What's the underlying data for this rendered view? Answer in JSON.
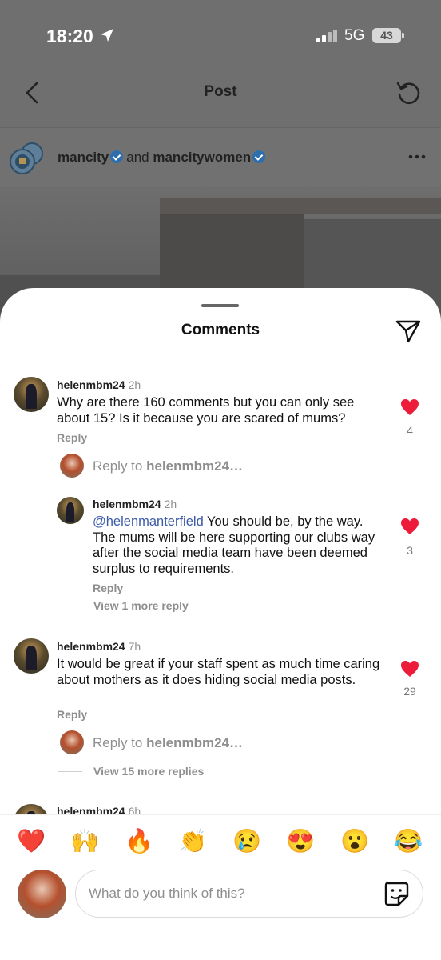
{
  "status_bar": {
    "time": "18:20",
    "network": "5G",
    "battery": "43"
  },
  "header": {
    "title": "Post"
  },
  "post": {
    "author_primary": "mancity",
    "author_joiner": "and",
    "author_secondary": "mancitywomen"
  },
  "sheet": {
    "title": "Comments"
  },
  "comments": [
    {
      "username": "helenmbm24",
      "time": "2h",
      "text": "Why are there 160 comments but you can only see about 15? Is it because you are scared of mums?",
      "likes": "4",
      "reply_label": "Reply",
      "reply_prompt_prefix": "Reply to",
      "reply_prompt_user": "helenmbm24…",
      "reply": {
        "username": "helenmbm24",
        "time": "2h",
        "mention": "@helenmanterfield",
        "text": " You should be, by the way. The mums will be here supporting our clubs way after the social media team have been deemed surplus to requirements.",
        "likes": "3",
        "reply_label": "Reply"
      },
      "more_replies": "View 1 more reply"
    },
    {
      "username": "helenmbm24",
      "time": "7h",
      "text": "It would be great if your staff spent as much time caring about mothers as it does hiding social media posts.",
      "likes": "29",
      "reply_label": "Reply",
      "reply_prompt_prefix": "Reply to",
      "reply_prompt_user": "helenmbm24…",
      "more_replies": "View 15 more replies"
    },
    {
      "username": "helenmbm24",
      "time": "6h"
    }
  ],
  "emoji_bar": [
    "❤️",
    "🙌",
    "🔥",
    "👏",
    "😢",
    "😍",
    "😮",
    "😂"
  ],
  "composer": {
    "placeholder": "What do you think of this?"
  },
  "colors": {
    "heart": "#ed1c3a",
    "mention": "#3b5aa8",
    "verified": "#2d6fae"
  }
}
